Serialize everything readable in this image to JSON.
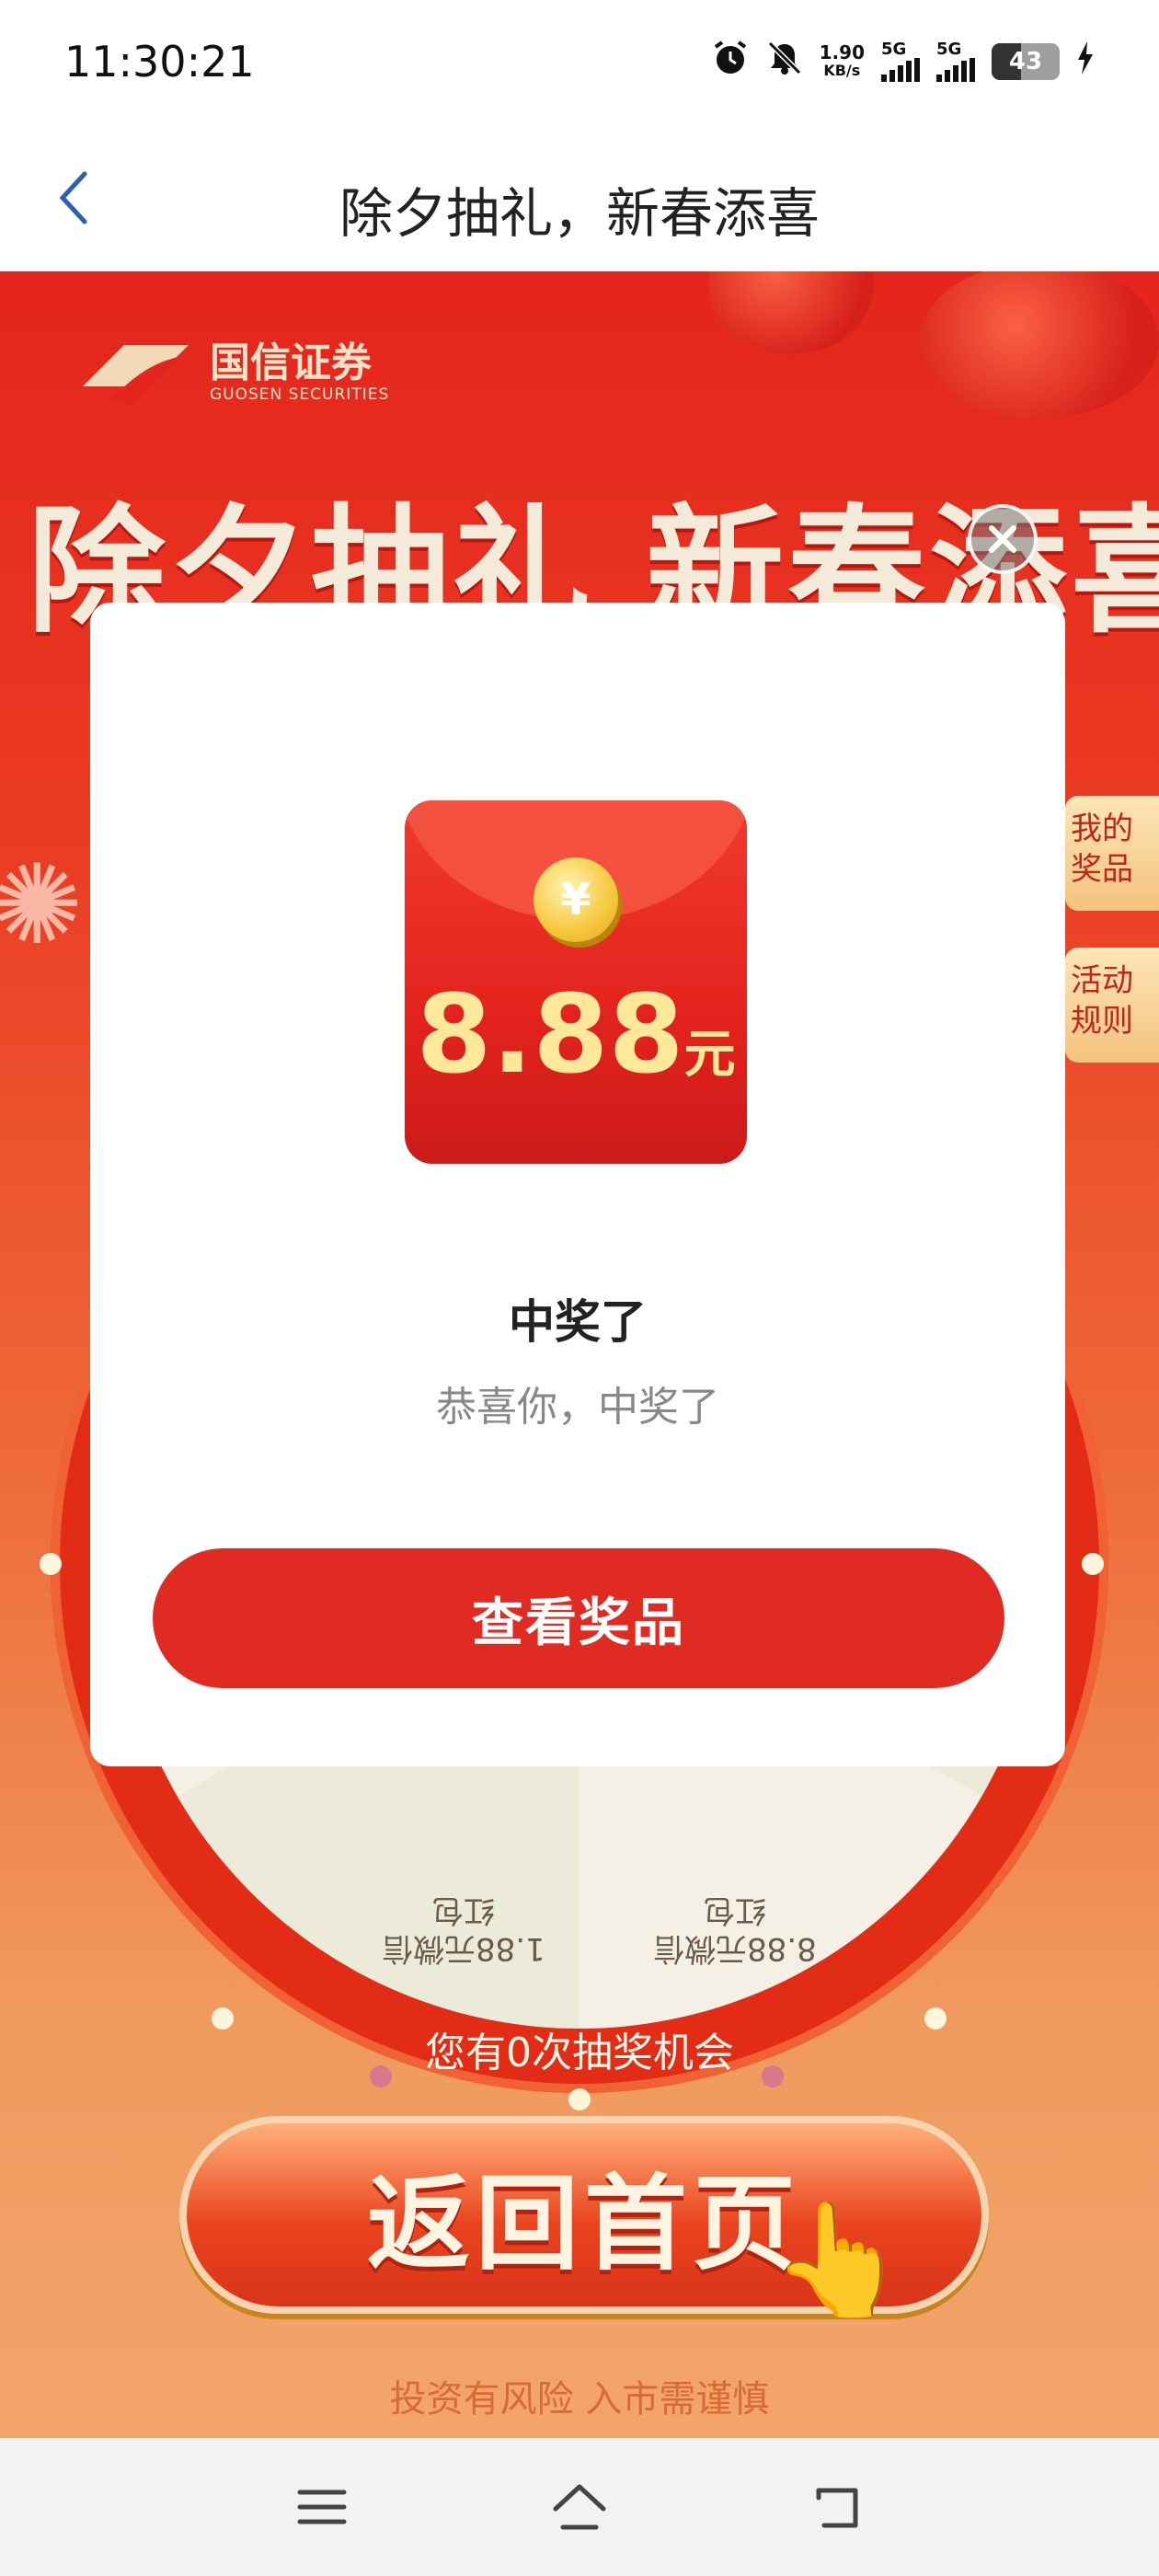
{
  "status_bar": {
    "time": "11:30:21",
    "net_speed_value": "1.90",
    "net_speed_unit": "KB/s",
    "signal1_label": "5G",
    "signal2_label": "5G",
    "battery_level": "43",
    "icons": [
      "alarm-icon",
      "bell-muted-icon",
      "signal-icon",
      "battery-icon",
      "charging-icon"
    ]
  },
  "header": {
    "title": "除夕抽礼，新春添喜",
    "back_icon": "chevron-left-icon"
  },
  "banner": {
    "logo_cn": "国信证券",
    "logo_en": "GUOSEN SECURITIES",
    "title": "除夕抽礼 新春添喜"
  },
  "side_tabs": [
    {
      "label_line1": "我的",
      "label_line2": "奖品"
    },
    {
      "label_line1": "活动",
      "label_line2": "规则"
    }
  ],
  "wheel": {
    "segments": [
      {
        "line1": "1.88元微信",
        "line2": "红包"
      },
      {
        "line1": "8.88元微信",
        "line2": "红包"
      }
    ]
  },
  "chances_text": "您有0次抽奖机会",
  "home_button_label": "返回首页",
  "risk_notice": "投资有风险  入市需谨慎",
  "modal": {
    "amount_value": "8.88",
    "amount_unit": "元",
    "coin_symbol": "¥",
    "title": "中奖了",
    "subtitle": "恭喜你，中奖了",
    "view_button_label": "查看奖品",
    "close_icon": "close-icon"
  },
  "nav_bar": {
    "icons": [
      "menu-icon",
      "home-icon",
      "back-icon"
    ]
  },
  "colors": {
    "primary_red": "#e02b23",
    "banner_red": "#e4251d",
    "gold": "#ffe89a"
  }
}
